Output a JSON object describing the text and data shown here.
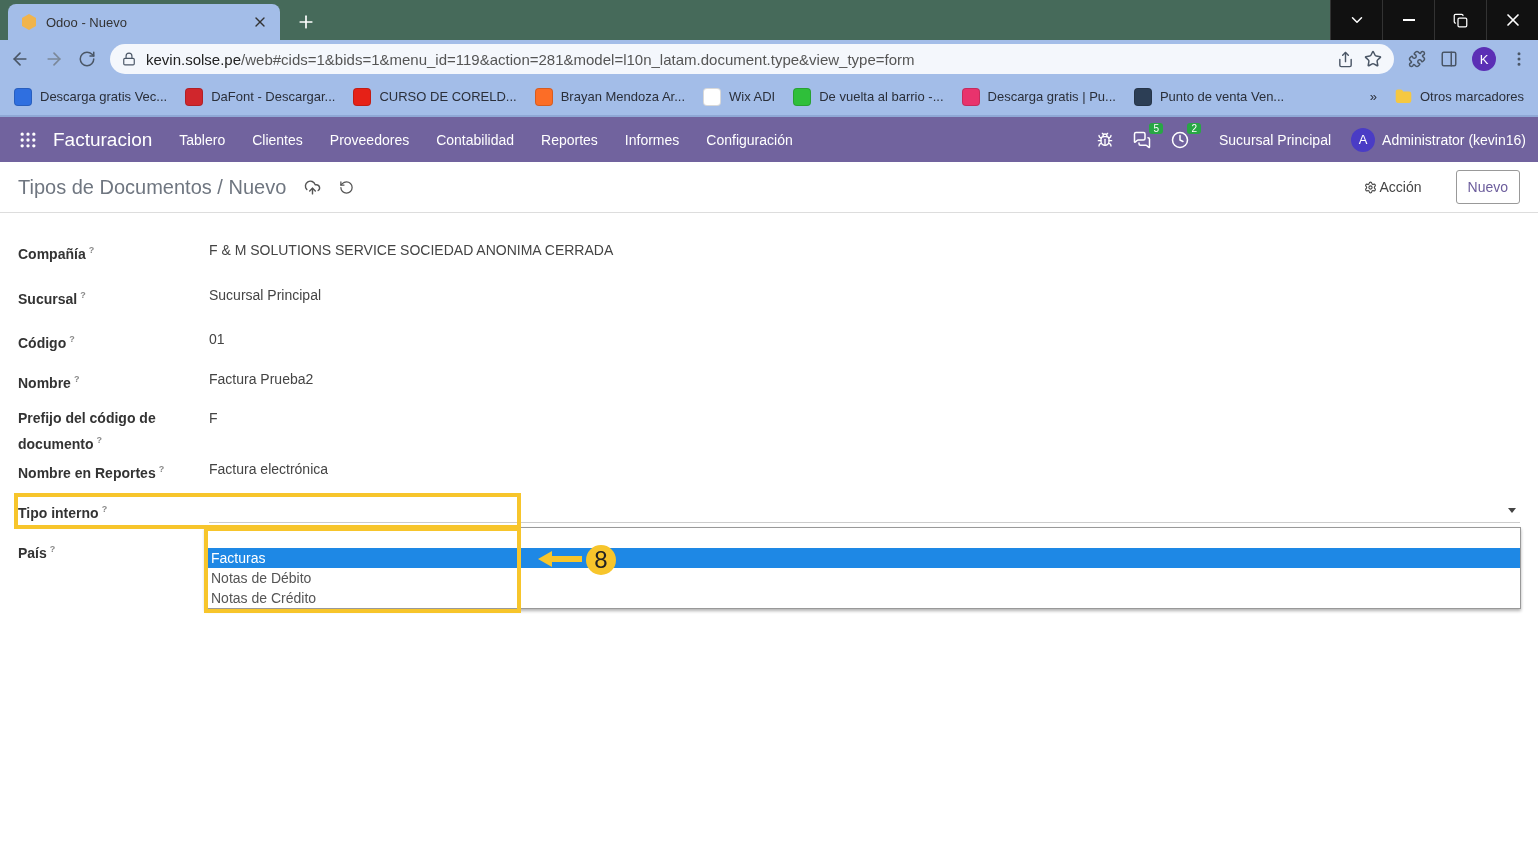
{
  "browser": {
    "tab_title": "Odoo - Nuevo",
    "url_host": "kevin.solse.pe",
    "url_path": "/web#cids=1&bids=1&menu_id=119&action=281&model=l10n_latam.document.type&view_type=form",
    "profile": "K",
    "bookmarks": [
      {
        "label": "Descarga gratis Vec...",
        "color": "#2f6fe0"
      },
      {
        "label": "DaFont - Descargar...",
        "color": "#d0262c"
      },
      {
        "label": "CURSO DE CORELD...",
        "color": "#e62117"
      },
      {
        "label": "Brayan Mendoza Ar...",
        "color": "#fc6d26"
      },
      {
        "label": "Wix ADI",
        "color": "#ffffff"
      },
      {
        "label": "De vuelta al barrio -...",
        "color": "#2fbf3a"
      },
      {
        "label": "Descarga gratis | Pu...",
        "color": "#e8336d"
      },
      {
        "label": "Punto de venta Ven...",
        "color": "#2c3e55"
      }
    ],
    "more": "»",
    "other_bookmarks": "Otros marcadores"
  },
  "app": {
    "brand": "Facturacion",
    "menu": [
      "Tablero",
      "Clientes",
      "Proveedores",
      "Contabilidad",
      "Reportes",
      "Informes",
      "Configuración"
    ],
    "messages_count": "5",
    "activities_count": "2",
    "branch": "Sucursal Principal",
    "avatar": "A",
    "user": "Administrator (kevin16)"
  },
  "control_panel": {
    "breadcrumb": [
      "Tipos de Documentos",
      "Nuevo"
    ],
    "separator": "/",
    "action": "Acción",
    "new_button": "Nuevo"
  },
  "form": {
    "fields": [
      {
        "label": "Compañía",
        "help": "?",
        "value": "F & M SOLUTIONS SERVICE SOCIEDAD ANONIMA CERRADA"
      },
      {
        "label": "Sucursal",
        "help": "?",
        "value": "Sucursal Principal"
      },
      {
        "label": "Código",
        "help": "?",
        "value": "01"
      },
      {
        "label": "Nombre",
        "help": "?",
        "value": "Factura Prueba2"
      },
      {
        "label": "Prefijo del código de documento",
        "help": "?",
        "value": "F"
      },
      {
        "label": "Nombre en Reportes",
        "help": "?",
        "value": "Factura electrónica"
      },
      {
        "label": "Tipo interno",
        "help": "?",
        "kind": "select"
      },
      {
        "label": "País",
        "help": "?"
      }
    ],
    "dropdown": [
      {
        "label": "Facturas",
        "selected": true
      },
      {
        "label": "Notas de Débito",
        "selected": false
      },
      {
        "label": "Notas de Crédito",
        "selected": false
      }
    ]
  },
  "annotation": {
    "number": "8"
  }
}
